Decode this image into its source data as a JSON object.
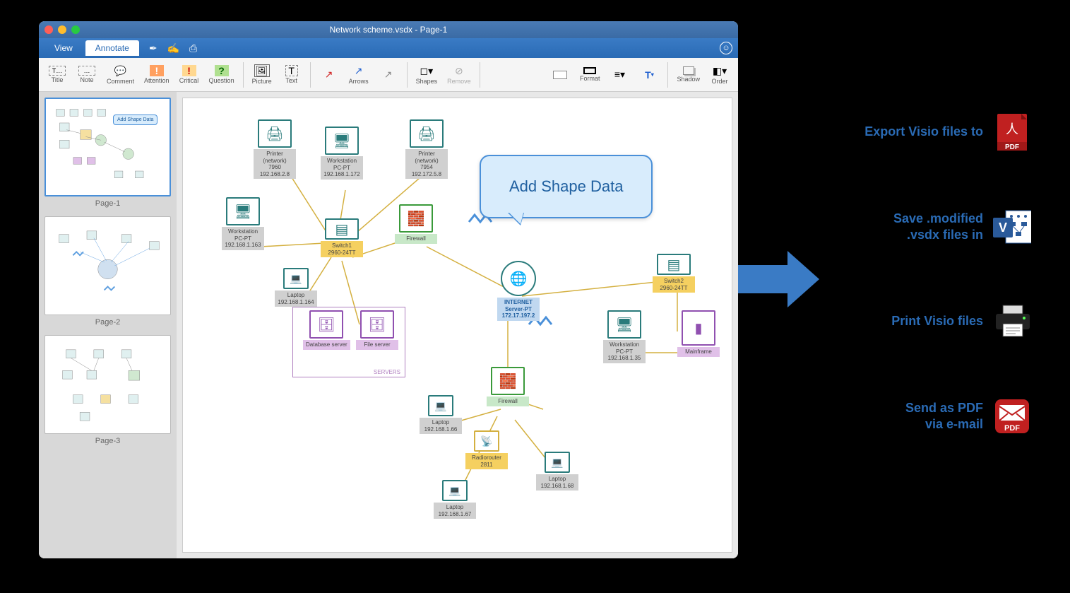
{
  "window": {
    "title": "Network scheme.vsdx - Page-1"
  },
  "tabs": {
    "view": "View",
    "annotate": "Annotate"
  },
  "toolbar": {
    "title": "Title",
    "note": "Note",
    "comment": "Comment",
    "attention": "Attention",
    "critical": "Critical",
    "question": "Question",
    "picture": "Picture",
    "text": "Text",
    "arrows": "Arrows",
    "shapes": "Shapes",
    "remove": "Remove",
    "format": "Format",
    "shadow": "Shadow",
    "order": "Order"
  },
  "pages": {
    "p1": "Page-1",
    "p2": "Page-2",
    "p3": "Page-3"
  },
  "callout": "Add Shape Data",
  "thumb_callout": "Add Shape Data",
  "nodes": {
    "printer1": {
      "name": "Printer\n(network)\n7960\n192.168.2.8"
    },
    "printer2": {
      "name": "Printer\n(network)\n7954\n192.172.5.8"
    },
    "ws1": {
      "name": "Workstation\nPC-PT\n192.168.1.172"
    },
    "ws2": {
      "name": "Workstation\nPC-PT\n192.168.1.163"
    },
    "ws3": {
      "name": "Workstation\nPC-PT\n192.168.1.35"
    },
    "switch1": {
      "name": "Switch1\n2960-24TT"
    },
    "switch2": {
      "name": "Switch2\n2960-24TT"
    },
    "firewall1": "Firewall",
    "firewall2": "Firewall",
    "laptop1": {
      "name": "Laptop\n192.168.1.164"
    },
    "laptop2": {
      "name": "Laptop\n192.168.1.66"
    },
    "laptop3": {
      "name": "Laptop\n192.168.1.67"
    },
    "laptop4": {
      "name": "Laptop\n192.168.1.68"
    },
    "internet": {
      "name": "INTERNET\nServer-PT\n172.17.197.2"
    },
    "dbserver": "Database server",
    "fileserver": "File server",
    "servers_label": "SERVERS",
    "radiorouter": {
      "name": "Radiorouter\n2811"
    },
    "mainframe": "Mainframe"
  },
  "features": {
    "export": "Export Visio files to",
    "save": "Save .modified\n.vsdx files in",
    "print": "Print Visio files",
    "send": "Send as PDF\nvia e-mail"
  },
  "icons": {
    "pdf": "PDF",
    "visio": "V",
    "pdf2": "PDF"
  }
}
